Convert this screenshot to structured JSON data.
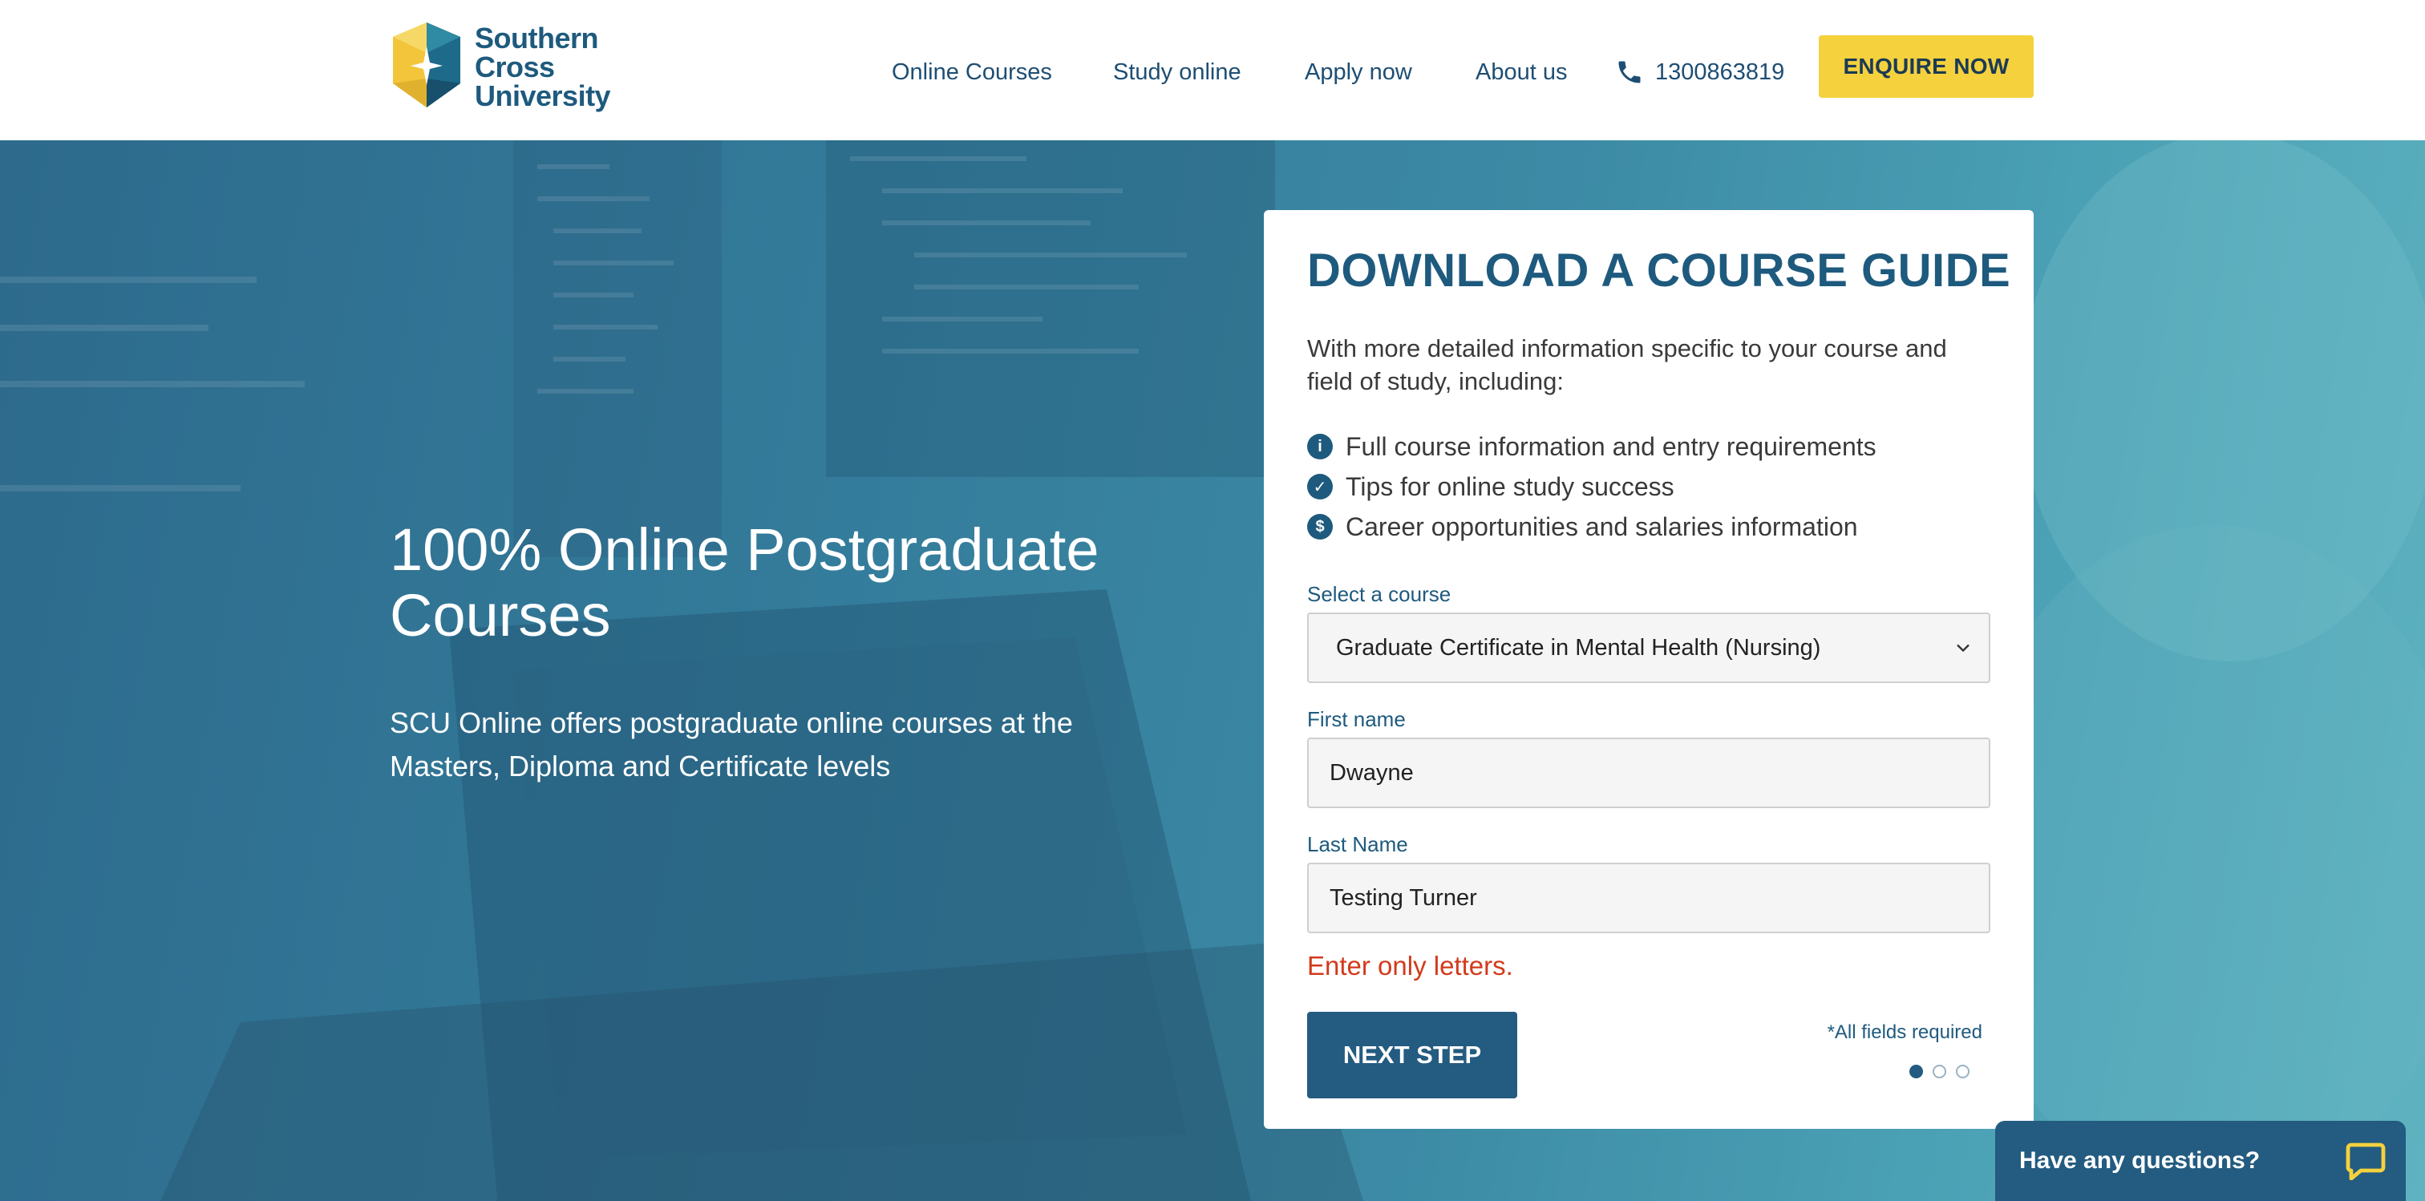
{
  "header": {
    "logo_line1": "Southern Cross",
    "logo_line2": "University",
    "nav": [
      {
        "label": "Online Courses"
      },
      {
        "label": "Study online"
      },
      {
        "label": "Apply now"
      },
      {
        "label": "About us"
      }
    ],
    "phone": "1300863819",
    "enquire_label": "ENQUIRE NOW"
  },
  "hero": {
    "title": "100% Online Postgraduate Courses",
    "subtitle": "SCU Online offers postgraduate online courses at the Masters, Diploma and Certificate levels"
  },
  "form": {
    "title": "DOWNLOAD A COURSE GUIDE",
    "intro": "With more detailed information specific to your course and field of study, including:",
    "bullets": [
      {
        "icon": "info-icon",
        "glyph": "i",
        "text": "Full course information and entry requirements"
      },
      {
        "icon": "check-icon",
        "glyph": "✓",
        "text": "Tips for online study success"
      },
      {
        "icon": "dollar-icon",
        "glyph": "$",
        "text": "Career opportunities and salaries information"
      }
    ],
    "course_label": "Select a course",
    "course_value": "Graduate Certificate in Mental Health (Nursing)",
    "first_name_label": "First name",
    "first_name_value": "Dwayne",
    "last_name_label": "Last Name",
    "last_name_value": "Testing Turner",
    "error": "Enter only letters.",
    "next_label": "NEXT STEP",
    "required_note": "*All fields required",
    "step": {
      "current": 1,
      "total": 3
    }
  },
  "chat": {
    "label": "Have any questions?"
  },
  "colors": {
    "brand_blue": "#1e5a7e",
    "button_blue": "#245b80",
    "accent_yellow": "#f4d13d",
    "error_red": "#d23a1c"
  }
}
